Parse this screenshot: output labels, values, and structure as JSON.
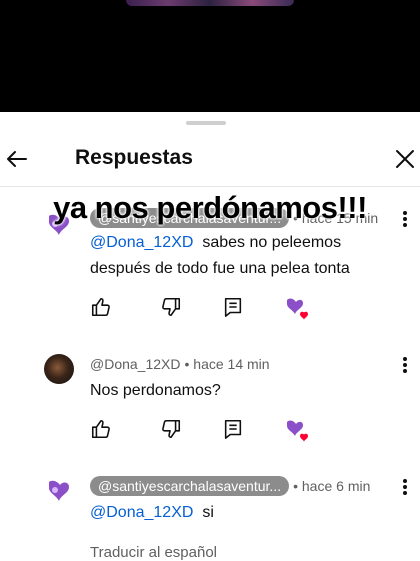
{
  "header": {
    "title": "Respuestas"
  },
  "overlay_caption": "ya nos perdónamos!!!",
  "comments": [
    {
      "author": "@santiyescarchalasaventur...",
      "time": "hace 15 min",
      "mention": "@Dona_12XD",
      "text_line1": "sabes no peleemos",
      "text_line2": "después de todo fue una pelea tonta"
    },
    {
      "author": "@Dona_12XD",
      "time": "hace 14 min",
      "text": "Nos perdonamos?"
    },
    {
      "author": "@santiyescarchalasaventur...",
      "time": "hace 6 min",
      "mention": "@Dona_12XD",
      "text": "si",
      "translate": "Traducir al español"
    }
  ],
  "colors": {
    "mention": "#065fd4",
    "heart": "#ff0033",
    "avatar_purple": "#8b4fc7"
  }
}
